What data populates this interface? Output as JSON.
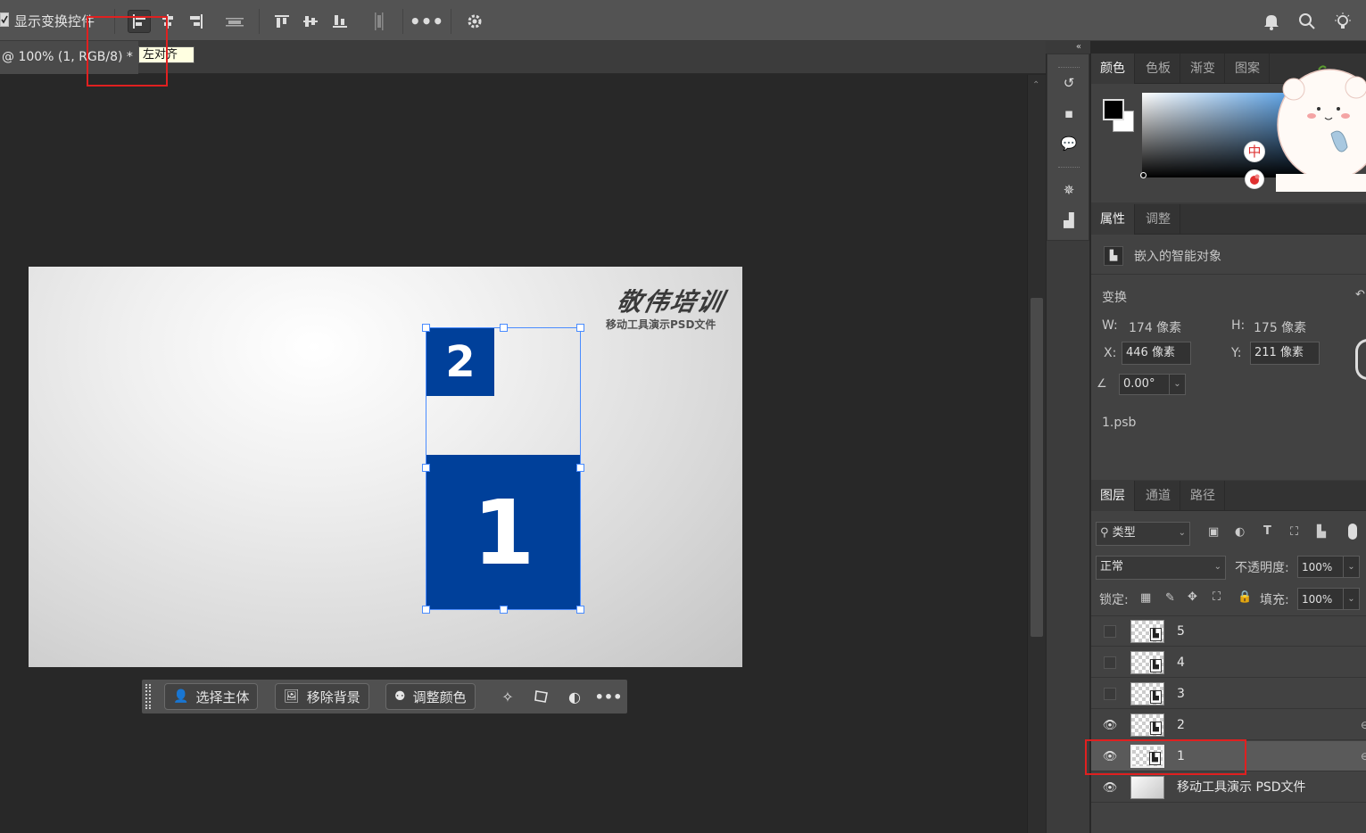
{
  "options_bar": {
    "show_transform_checkbox": true,
    "show_transform_label": "显示变换控件"
  },
  "doc_tab": {
    "caption": "@ 100% (1, RGB/8) *",
    "close": "×"
  },
  "tooltip": "左对齐",
  "artboard": {
    "logo": "敬伟培训",
    "subtitle": "移动工具演示PSD文件",
    "square_small": "2",
    "square_large": "1"
  },
  "context_bar": {
    "select_subject": "选择主体",
    "remove_bg": "移除背景",
    "adjust_color": "调整颜色"
  },
  "toolstrip_collapse": "«",
  "color_panel": {
    "tabs": [
      "颜色",
      "色板",
      "渐变",
      "图案"
    ],
    "foreground": "#000000",
    "background": "#ffffff"
  },
  "properties_panel": {
    "tabs": [
      "属性",
      "调整"
    ],
    "object_type": "嵌入的智能对象",
    "section_transform": "变换",
    "w_label": "W:",
    "w_value": "174 像素",
    "h_label": "H:",
    "h_value": "175 像素",
    "x_label": "X:",
    "x_value": "446 像素",
    "y_label": "Y:",
    "y_value": "211 像素",
    "angle_value": "0.00°",
    "file_name": "1.psb"
  },
  "layers_panel": {
    "tabs": [
      "图层",
      "通道",
      "路径"
    ],
    "filter_label": "类型",
    "blend_mode": "正常",
    "opacity_label": "不透明度:",
    "opacity_value": "100%",
    "lock_label": "锁定:",
    "fill_label": "填充:",
    "fill_value": "100%",
    "layers": [
      {
        "name": "5",
        "visible": false,
        "selected": false
      },
      {
        "name": "4",
        "visible": false,
        "selected": false
      },
      {
        "name": "3",
        "visible": false,
        "selected": false
      },
      {
        "name": "2",
        "visible": true,
        "selected": false
      },
      {
        "name": "1",
        "visible": true,
        "selected": true
      },
      {
        "name": "移动工具演示 PSD文件",
        "visible": true,
        "selected": false
      }
    ]
  },
  "sticker_glyph": "中",
  "colors": {
    "accent_blue": "#00409a",
    "highlight_red": "#e02020",
    "selection_blue": "#4a8cff"
  }
}
